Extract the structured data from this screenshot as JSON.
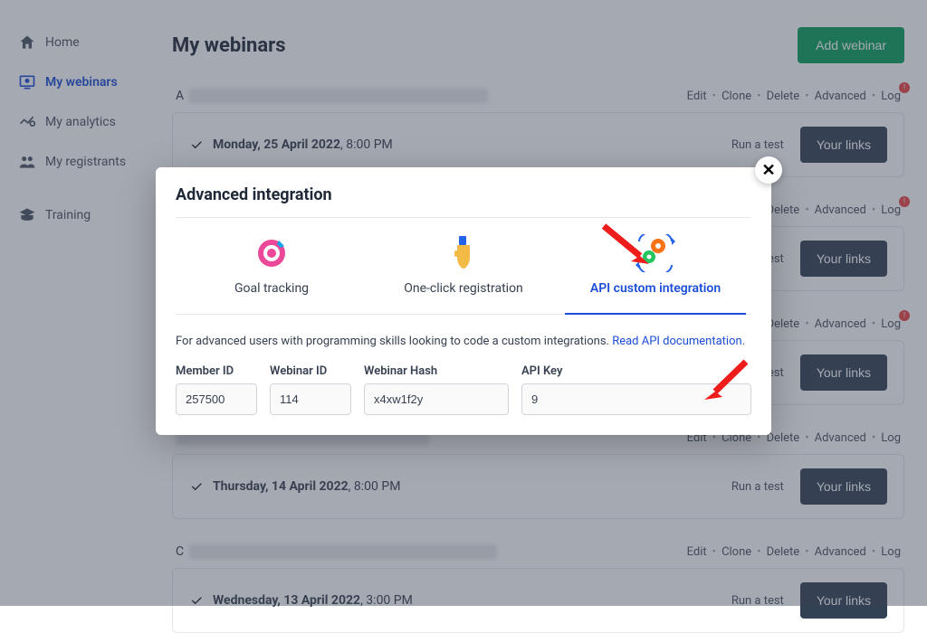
{
  "sidebar": {
    "items": [
      {
        "label": "Home"
      },
      {
        "label": "My webinars"
      },
      {
        "label": "My analytics"
      },
      {
        "label": "My registrants"
      },
      {
        "label": "Training"
      }
    ]
  },
  "header": {
    "title": "My webinars",
    "add_btn": "Add webinar"
  },
  "actions": {
    "edit": "Edit",
    "clone": "Clone",
    "delete": "Delete",
    "advanced": "Advanced",
    "log": "Log",
    "run_test": "Run a test",
    "your_links": "Your links"
  },
  "webinars": [
    {
      "prefix": "A",
      "date_strong": "Monday, 25 April 2022",
      "date_time": ", 8:00 PM",
      "alert": true
    },
    {
      "prefix": "",
      "date_strong": "",
      "date_time": "",
      "alert": true
    },
    {
      "prefix": "",
      "date_strong": "",
      "date_time": "",
      "alert": true
    },
    {
      "prefix": "",
      "date_strong": "",
      "date_time": "",
      "alert": false
    },
    {
      "prefix": "",
      "date_strong": "Thursday, 14 April 2022",
      "date_time": ", 8:00 PM",
      "alert": false
    },
    {
      "prefix": "C",
      "date_strong": "Wednesday, 13 April 2022",
      "date_time": ", 3:00 PM",
      "alert": false
    }
  ],
  "modal": {
    "title": "Advanced integration",
    "tabs": {
      "goal": "Goal tracking",
      "oneclick": "One-click registration",
      "api": "API custom integration"
    },
    "desc_text": "For advanced users with programming skills looking to code a custom integrations. ",
    "desc_link": "Read API documentation",
    "fields": {
      "member_id": {
        "label": "Member ID",
        "value": "257500"
      },
      "webinar_id": {
        "label": "Webinar ID",
        "value": "114"
      },
      "webinar_hash": {
        "label": "Webinar Hash",
        "value": "x4xw1f2y"
      },
      "api_key": {
        "label": "API Key",
        "value": "9"
      }
    }
  }
}
